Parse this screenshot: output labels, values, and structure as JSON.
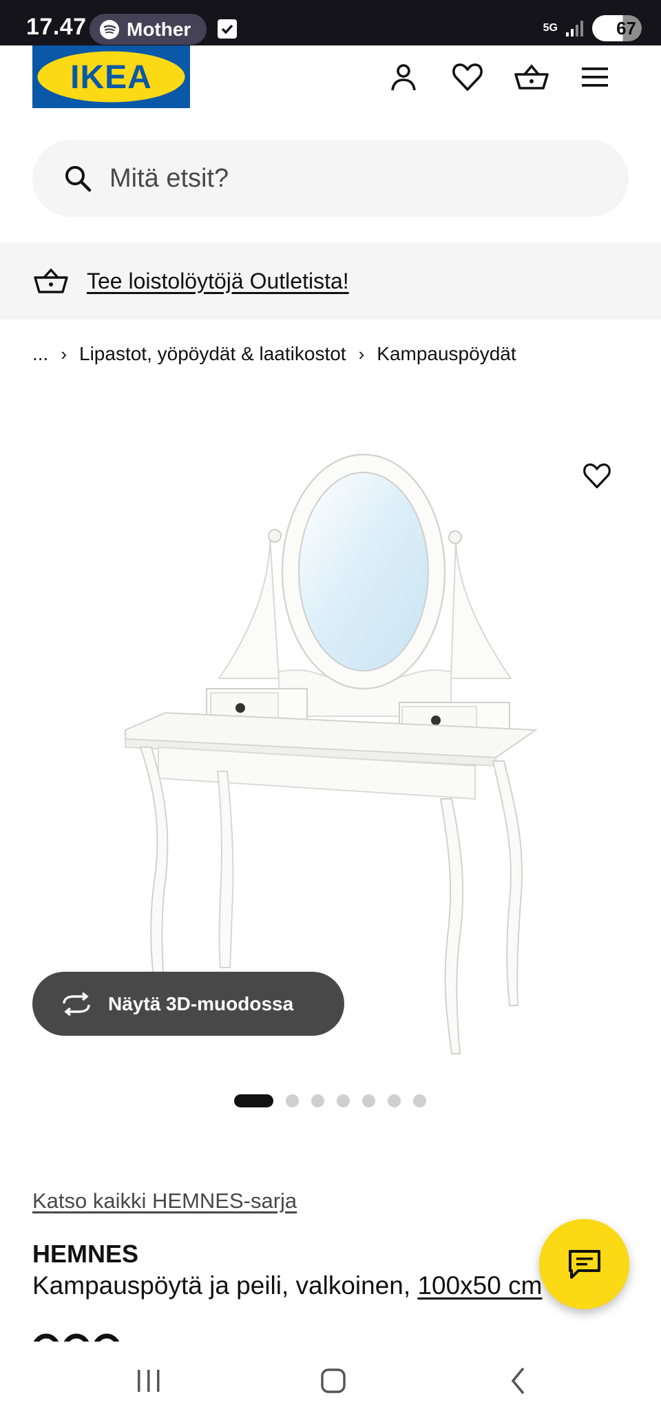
{
  "status_bar": {
    "time": "17.47",
    "media_app": "Mother",
    "network": "5G",
    "battery": "67"
  },
  "header": {
    "logo_text": "IKEA",
    "icons": [
      "account-icon",
      "heart-icon",
      "basket-icon",
      "menu-icon"
    ]
  },
  "search": {
    "placeholder": "Mitä etsit?"
  },
  "promo": {
    "link_text": "Tee loistolöytöjä Outletista!"
  },
  "breadcrumb": {
    "items": [
      "...",
      "Lipastot, yöpöydät & laatikostot",
      "Kampauspöydät"
    ]
  },
  "gallery": {
    "view_3d_label": "Näytä 3D-muodossa",
    "image_count": 7,
    "active_index": 0
  },
  "product": {
    "series_link": "Katso kaikki HEMNES-sarja",
    "name": "HEMNES",
    "description": "Kampauspöytä ja peili, valkoinen, ",
    "dimensions": "100x50 cm"
  },
  "colors": {
    "ikea_blue": "#0058a3",
    "ikea_yellow": "#fbd914",
    "dark_button": "#484848",
    "panel_grey": "#f5f5f5"
  }
}
